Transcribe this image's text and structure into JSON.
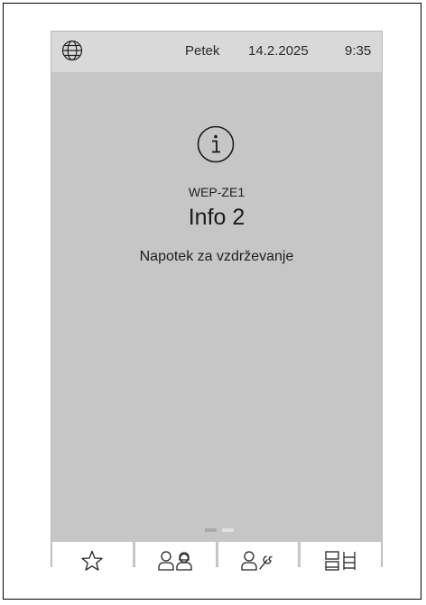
{
  "status_bar": {
    "day": "Petek",
    "date": "14.2.2025",
    "time": "9:35",
    "language_icon": "globe-icon"
  },
  "message": {
    "icon": "info-icon",
    "code": "WEP-ZE1",
    "title": "Info 2",
    "subtitle": "Napotek za vzdrževanje"
  },
  "pager": {
    "pages": 2,
    "active": 1
  },
  "bottom_nav": [
    {
      "icon": "star-icon"
    },
    {
      "icon": "users-icon"
    },
    {
      "icon": "user-wrench-icon"
    },
    {
      "icon": "system-icon"
    }
  ],
  "colors": {
    "screen_bg": "#c6c6c6",
    "status_bg": "#d9d9d9",
    "button_bg": "#ffffff",
    "text": "#1a1a1a"
  }
}
